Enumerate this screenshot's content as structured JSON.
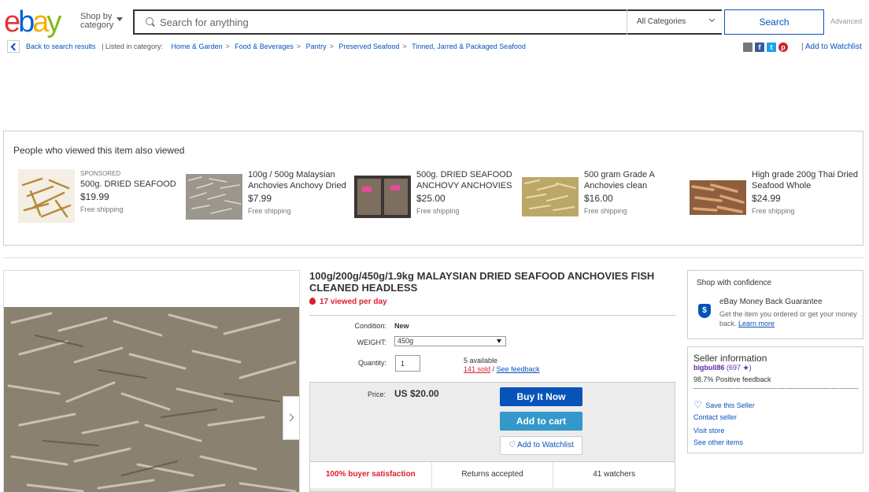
{
  "header": {
    "logo": {
      "e": "e",
      "b": "b",
      "a": "a",
      "y": "y"
    },
    "shop_by_category": "Shop by category",
    "search_placeholder": "Search for anything",
    "category_select": "All Categories",
    "search_button": "Search",
    "advanced_link": "Advanced"
  },
  "breadcrumb": {
    "back": "Back to search results",
    "listed_in": "| Listed in category:",
    "items": [
      "Home & Garden",
      "Pantry",
      "Preserved Seafood",
      "Tinned, Jarred & Packaged Seafood"
    ],
    "food": "Food & Beverages",
    "sep": ">"
  },
  "share": {
    "add_to_watchlist": "Add to Watchlist",
    "pipe": "|"
  },
  "also_viewed": {
    "heading": "People who viewed this item also viewed",
    "items": [
      {
        "sponsored": "SPONSORED",
        "title": "500g. DRIED SEAFOOD",
        "price": "$19.99",
        "shipping": "Free shipping",
        "thumb_color": "#c79a4a"
      },
      {
        "sponsored": "",
        "title": "100g / 500g Malaysian Anchovies Anchovy Dried",
        "price": "$7.99",
        "shipping": "Free shipping",
        "thumb_color": "#b9b3a8"
      },
      {
        "sponsored": "",
        "title": "500g. DRIED SEAFOOD ANCHOVY ANCHOVIES",
        "price": "$25.00",
        "shipping": "Free shipping",
        "thumb_color": "#6a5d52"
      },
      {
        "sponsored": "",
        "title": "500 gram Grade A Anchovies clean",
        "price": "$16.00",
        "shipping": "Free shipping",
        "thumb_color": "#c5b06a"
      },
      {
        "sponsored": "",
        "title": "High grade 200g Thai Dried Seafood Whole",
        "price": "$24.99",
        "shipping": "Free shipping",
        "thumb_color": "#b5825b"
      }
    ]
  },
  "item": {
    "title": "100g/200g/450g/1.9kg MALAYSIAN DRIED SEAFOOD ANCHOVIES FISH CLEANED HEADLESS",
    "viewed": "17 viewed per day",
    "condition_label": "Condition:",
    "condition_value": "New",
    "weight_label": "WEIGHT:",
    "weight_value": "450g",
    "quantity_label": "Quantity:",
    "quantity_value": "1",
    "available": "5 available",
    "sold": "141 sold",
    "slash": "/",
    "see_feedback": "See feedback",
    "price_label": "Price:",
    "price": "US $20.00",
    "buy_now": "Buy It Now",
    "add_to_cart": "Add to cart",
    "add_to_watchlist": "Add to Watchlist",
    "stats": [
      "100% buyer satisfaction",
      "Returns accepted",
      "41 watchers"
    ]
  },
  "confidence": {
    "heading": "Shop with confidence",
    "shield": "$",
    "guarantee_title": "eBay Money Back Guarantee",
    "guarantee_text": "Get the item you ordered or get your money back.",
    "learn_more": "Learn more"
  },
  "seller": {
    "heading": "Seller information",
    "name": "bigbull86",
    "score": "(697",
    "star": "★",
    "close": ")",
    "feedback": "98.7% Positive feedback",
    "save": "Save this Seller",
    "links": [
      "Contact seller",
      "Visit store",
      "See other items"
    ]
  },
  "colors": {
    "accent": "#0654ba",
    "buy": "#0654ba",
    "cart": "#3498ca",
    "alert": "#dd1e31"
  }
}
